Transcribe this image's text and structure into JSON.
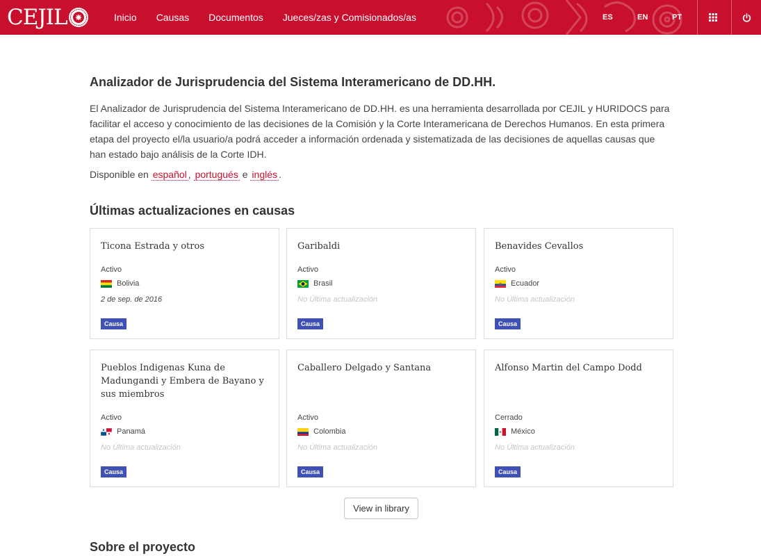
{
  "header": {
    "logo_text": "CEJIL",
    "nav": [
      "Inicio",
      "Causas",
      "Documentos",
      "Jueces/zas y Comisionados/as"
    ],
    "languages": [
      "ES",
      "EN",
      "PT"
    ],
    "brand_color": "#c8102e"
  },
  "intro": {
    "title": "Analizador de Jurisprudencia del Sistema Interamericano de DD.HH.",
    "paragraph": "El Analizador de Jurisprudencia del Sistema Interamericano de DD.HH. es una herramienta desarrollada por CEJIL y HURIDOCS para facilitar el acceso y conocimiento de las decisiones de la Comisión y la Corte Interamericana de Derechos Humanos. En esta primera etapa del proyecto el/la usuario/a podrá acceder a información ordenada y sistematizada de las decisiones de aquellas causas que han estado bajo análisis de la Corte IDH.",
    "available_prefix": "Disponible en",
    "lang_spanish": "español",
    "lang_sep1": ",",
    "lang_portuguese": "portugués",
    "lang_sep2": "e",
    "lang_english": "inglés",
    "lang_end": "."
  },
  "updates": {
    "section_title": "Últimas actualizaciones en causas",
    "cards": [
      {
        "title": "Ticona Estrada y otros",
        "status": "Activo",
        "country": "Bolivia",
        "flag": "bolivia-flag-icon",
        "date": "2 de sep. de 2016",
        "badge": "Causa"
      },
      {
        "title": "Garibaldi",
        "status": "Activo",
        "country": "Brasil",
        "flag": "brazil-flag-icon",
        "date": "No Última actualización",
        "badge": "Causa"
      },
      {
        "title": "Benavides Cevallos",
        "status": "Activo",
        "country": "Ecuador",
        "flag": "ecuador-flag-icon",
        "date": "No Última actualización",
        "badge": "Causa"
      },
      {
        "title": "Pueblos Indigenas Kuna de Madungandi y Embera de Bayano y sus miembros",
        "status": "Activo",
        "country": "Panamá",
        "flag": "panama-flag-icon",
        "date": "No Última actualización",
        "badge": "Causa"
      },
      {
        "title": "Caballero Delgado y Santana",
        "status": "Activo",
        "country": "Colombia",
        "flag": "colombia-flag-icon",
        "date": "No Última actualización",
        "badge": "Causa"
      },
      {
        "title": "Alfonso Martin del Campo Dodd",
        "status": "Cerrado",
        "country": "México",
        "flag": "mexico-flag-icon",
        "date": "No Última actualización",
        "badge": "Causa"
      }
    ],
    "button": "View in library"
  },
  "about": {
    "title": "Sobre el proyecto"
  },
  "colors": {
    "badge": "#3f51b5",
    "link": "#c8102e"
  }
}
